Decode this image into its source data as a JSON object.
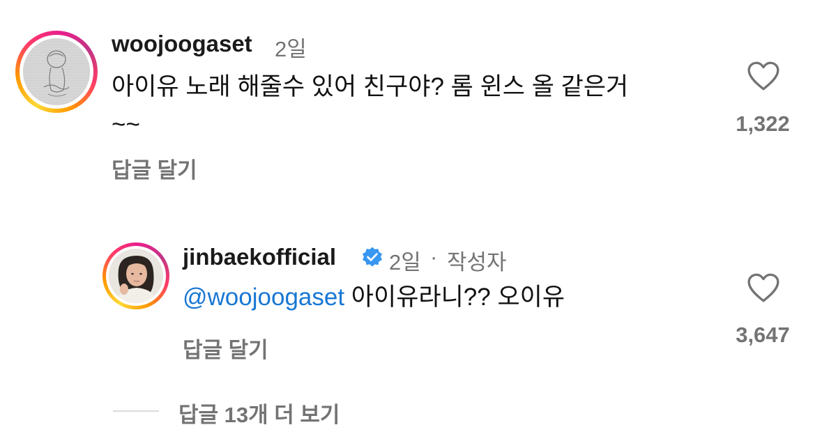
{
  "comment": {
    "username": "woojoogaset",
    "time": "2일",
    "text_line1": "아이유 노래 해줄수 있어 친구야? 롬 윈스 올 같은거",
    "text_line2": "~~",
    "reply_label": "답글 달기",
    "like_count": "1,322",
    "avatar_icon": "sketch-avatar-icon",
    "like_icon": "heart-outline-icon"
  },
  "reply": {
    "username": "jinbaekofficial",
    "verified_icon": "verified-badge-icon",
    "time": "2일",
    "separator": "·",
    "author_tag": "작성자",
    "mention": "@woojoogaset",
    "text": " 아이유라니?? 오이유",
    "reply_label": "답글 달기",
    "like_count": "3,647",
    "like_icon": "heart-outline-icon"
  },
  "more_replies": {
    "label": "답글 13개 더 보기"
  },
  "colors": {
    "mention": "#1877d4",
    "secondary_text": "#737373",
    "verified": "#3897f0"
  }
}
